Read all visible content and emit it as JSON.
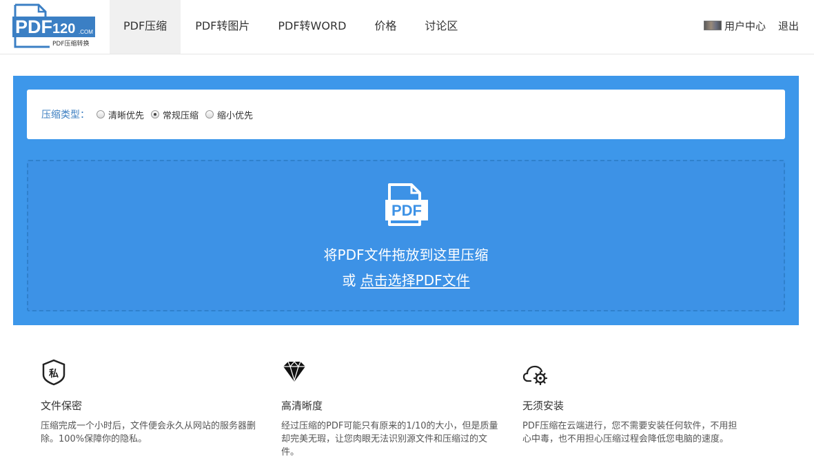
{
  "header": {
    "logo": {
      "main": "PDF",
      "num": "120",
      "com": ".COM",
      "tagline": "PDF压缩转换"
    },
    "nav": [
      {
        "label": "PDF压缩",
        "active": true
      },
      {
        "label": "PDF转图片",
        "active": false
      },
      {
        "label": "PDF转WORD",
        "active": false
      },
      {
        "label": "价格",
        "active": false
      },
      {
        "label": "讨论区",
        "active": false
      }
    ],
    "user_center": "用户中心",
    "logout": "退出"
  },
  "compress": {
    "label": "压缩类型：",
    "options": [
      {
        "label": "清晰优先",
        "checked": false
      },
      {
        "label": "常规压缩",
        "checked": true
      },
      {
        "label": "缩小优先",
        "checked": false
      }
    ]
  },
  "dropzone": {
    "icon_text": "PDF",
    "line1": "将PDF文件拖放到这里压缩",
    "or": "或",
    "link": "点击选择PDF文件"
  },
  "features": [
    {
      "icon": "privacy-shield-icon",
      "icon_text": "私",
      "title": "文件保密",
      "desc": "压缩完成一个小时后，文件便会永久从网站的服务器删除。100%保障你的隐私。"
    },
    {
      "icon": "diamond-icon",
      "title": "高清晰度",
      "desc": "经过压缩的PDF可能只有原来的1/10的大小，但是质量却完美无瑕，让您肉眼无法识别源文件和压缩过的文件。"
    },
    {
      "icon": "cloud-gear-icon",
      "title": "无须安装",
      "desc": "PDF压缩在云端进行，您不需要安装任何软件，不用担心中毒，也不用担心压缩过程会降低您电脑的速度。"
    }
  ],
  "colors": {
    "brand_blue": "#3d97ea",
    "logo_blue": "#3b7fc4",
    "nav_active_bg": "#f0f0f0"
  }
}
